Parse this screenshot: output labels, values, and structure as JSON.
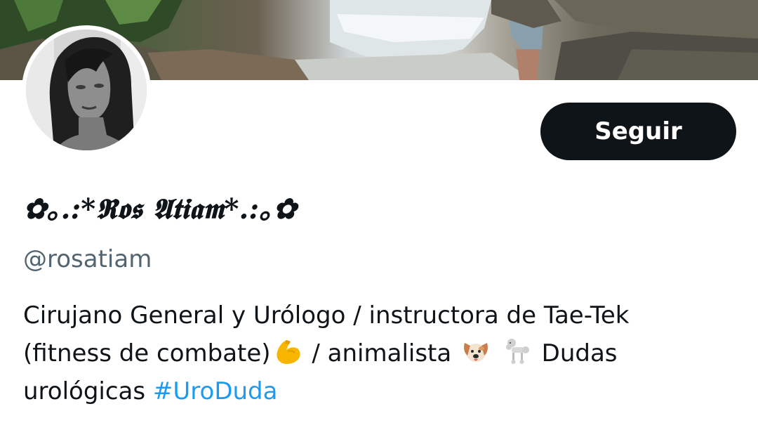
{
  "profile": {
    "display_name": "✿｡.:*𝕽𝖔𝖘 𝕬𝖙𝖎𝖆𝖒*.:｡✿",
    "handle": "@rosatiam",
    "follow_label": "Seguir",
    "bio": {
      "line1": "Cirujano General y Urólogo / instructora de Tae-Tek",
      "line2_a": "(fitness de combate)",
      "line2_b": "/ animalista",
      "line2_c": "Dudas",
      "line3_a": "urológicas",
      "hashtag": "#UroDuda"
    }
  },
  "icons": {
    "banner": "waterfall-photo",
    "avatar": "profile-photo",
    "emoji_1": "flexed-biceps-icon",
    "emoji_2": "dog-face-icon",
    "emoji_3": "poodle-icon"
  },
  "colors": {
    "primary_text": "#0f1419",
    "secondary_text": "#536471",
    "link": "#1d9bf0",
    "button_bg": "#0f1419"
  }
}
